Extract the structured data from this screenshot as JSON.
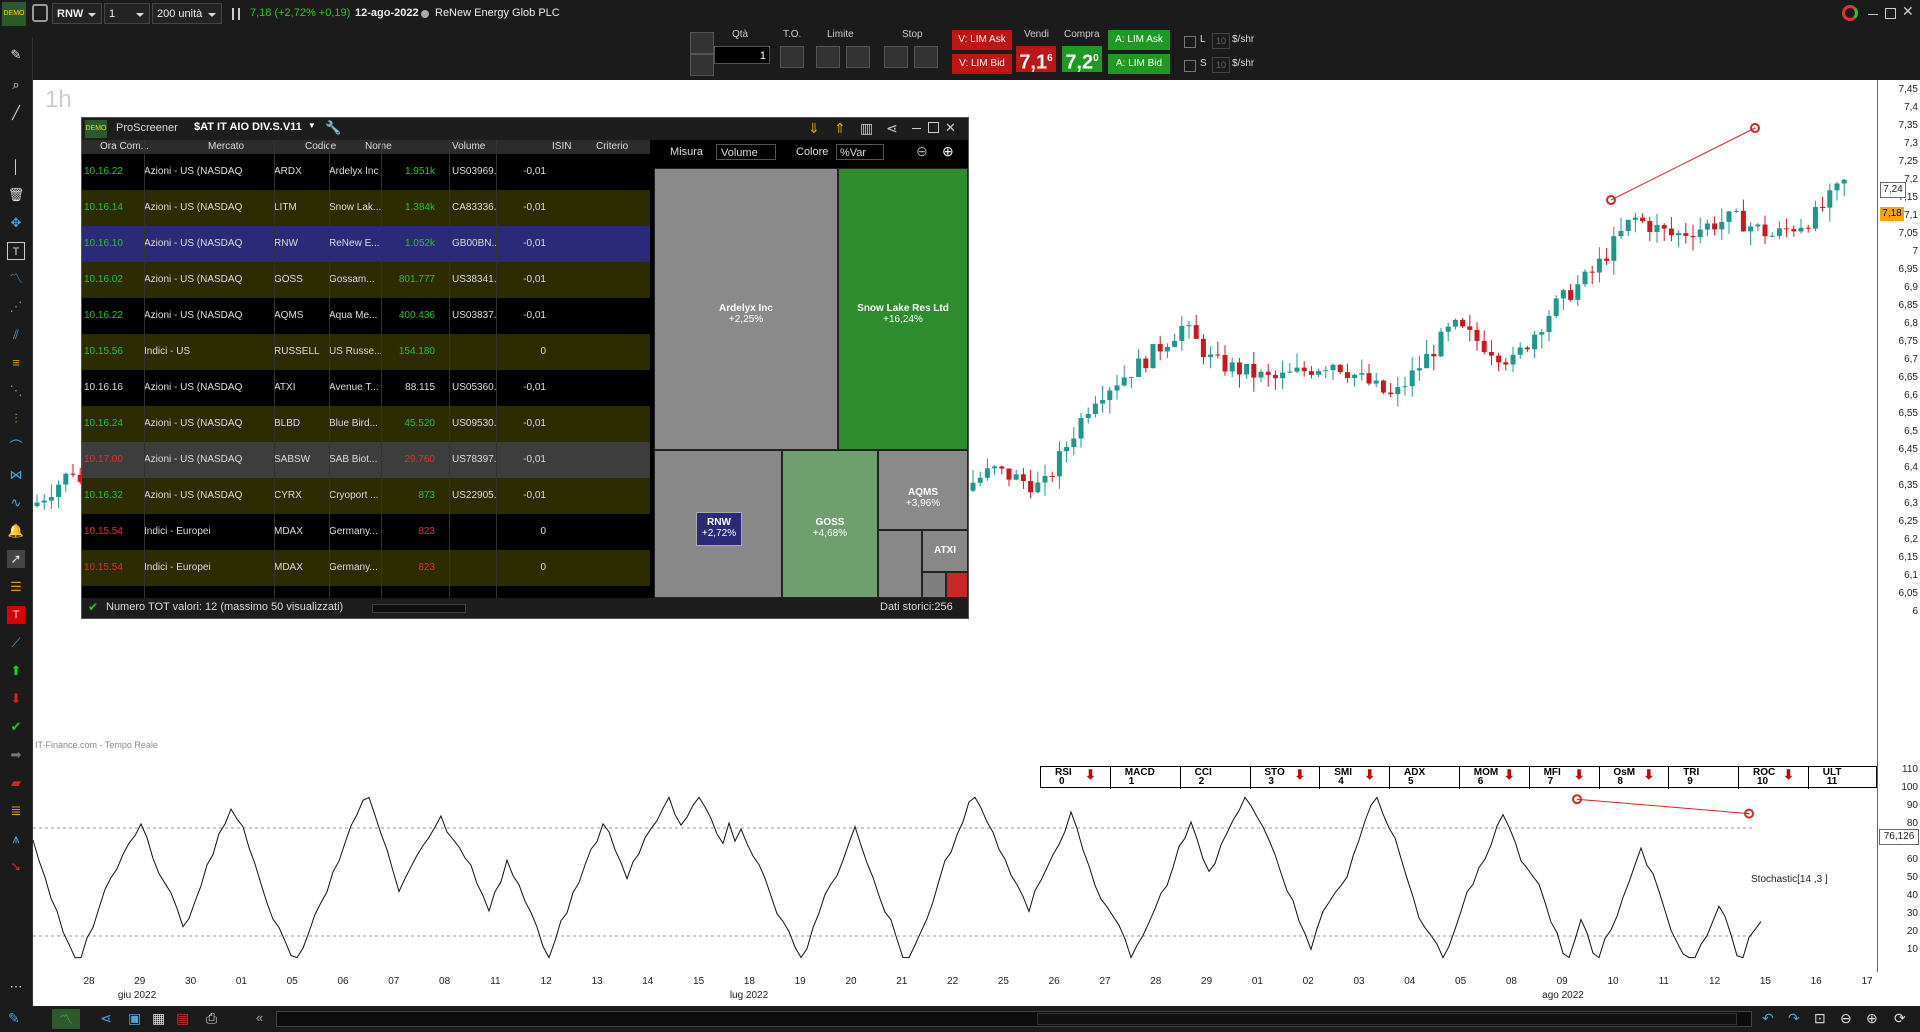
{
  "topbar": {
    "symbol": "RNW",
    "timeframe": "1 ora",
    "units": "200 unità",
    "last_price": "7,18 (+2,72% +0,19)",
    "date": "12-ago-2022",
    "company": "ReNew Energy Glob PLC",
    "logo_text": "DEMO"
  },
  "order": {
    "qty_label": "Qtà",
    "qty_value": "1",
    "to_label": "T.O.",
    "limit_label": "Limite",
    "stop_label": "Stop",
    "sell_label": "Vendi",
    "buy_label": "Compra",
    "v_lim_ask": "V: LIM Ask",
    "v_lim_bid": "V: LIM Bid",
    "a_lim_ask": "A: LIM Ask",
    "a_lim_bid": "A: LIM Bid",
    "sell_price": "7,1",
    "sell_sup": "6",
    "buy_price": "7,2",
    "buy_sup": "0",
    "l_label": "L",
    "s_label": "S",
    "l_val": "10",
    "s_val": "10",
    "per_share": "$/shr"
  },
  "chart": {
    "timeframe_label": "1h",
    "source": "IT-Finance.com - Tempo Reale",
    "price_axis": [
      "7,45",
      "7,4",
      "7,35",
      "7,3",
      "7,25",
      "7,2",
      "7,15",
      "7,1",
      "7,05",
      "7",
      "6,95",
      "6,9",
      "6,85",
      "6,8",
      "6,75",
      "6,7",
      "6,65",
      "6,6",
      "6,55",
      "6,5",
      "6,45",
      "6,4",
      "6,35",
      "6,3",
      "6,25",
      "6,2",
      "6,15",
      "6,1",
      "6,05",
      "6"
    ],
    "price_tag_1": "7,24",
    "price_tag_2": "7,18",
    "colors": {
      "up": "#1a9a8c",
      "down": "#d4141c",
      "bg": "#ffffff",
      "line": "#e02020"
    }
  },
  "oscillator": {
    "name": "Stochastic[14 ,3 ]",
    "value": "76,126",
    "axis": [
      "110",
      "100",
      "90",
      "80",
      "70",
      "60",
      "50",
      "40",
      "30",
      "20",
      "10"
    ],
    "indicators": [
      {
        "name": "RSI",
        "num": "0",
        "arrow": true
      },
      {
        "name": "MACD",
        "num": "1",
        "arrow": false
      },
      {
        "name": "CCI",
        "num": "2",
        "arrow": false
      },
      {
        "name": "STO",
        "num": "3",
        "arrow": true
      },
      {
        "name": "SMI",
        "num": "4",
        "arrow": true
      },
      {
        "name": "ADX",
        "num": "5",
        "arrow": false
      },
      {
        "name": "MOM",
        "num": "6",
        "arrow": true
      },
      {
        "name": "MFI",
        "num": "7",
        "arrow": true
      },
      {
        "name": "OsM",
        "num": "8",
        "arrow": true
      },
      {
        "name": "TRI",
        "num": "9",
        "arrow": false
      },
      {
        "name": "ROC",
        "num": "10",
        "arrow": true
      },
      {
        "name": "ULT",
        "num": "11",
        "arrow": false
      }
    ]
  },
  "xaxis": {
    "ticks": [
      "28",
      "29",
      "30",
      "01",
      "05",
      "06",
      "07",
      "08",
      "11",
      "12",
      "13",
      "14",
      "15",
      "18",
      "19",
      "20",
      "21",
      "22",
      "25",
      "26",
      "27",
      "28",
      "29",
      "01",
      "02",
      "03",
      "04",
      "05",
      "08",
      "09",
      "10",
      "11",
      "12",
      "15",
      "16",
      "17"
    ],
    "months": [
      "giu 2022",
      "lug 2022",
      "ago 2022"
    ]
  },
  "screener": {
    "app": "ProScreener",
    "name": "$AT IT AIO DIV.S.V11",
    "columns": [
      "Ora Com...",
      "Mercato",
      "Codice",
      "Nome",
      "Volume",
      "ISIN",
      "Criterio"
    ],
    "rows": [
      {
        "time": "10.16.22",
        "market": "Azioni - US (NASDAQ",
        "code": "ARDX",
        "name": "Ardelyx Inc",
        "volume": "1.951k",
        "isin": "US03969...",
        "crit": "-0,01",
        "bg": "#000000",
        "tc": "#27c627",
        "vc": "#27c627"
      },
      {
        "time": "10.16.14",
        "market": "Azioni - US (NASDAQ",
        "code": "LITM",
        "name": "Snow Lak...",
        "volume": "1.384k",
        "isin": "CA83336...",
        "crit": "-0,01",
        "bg": "#2d2b00",
        "tc": "#27c627",
        "vc": "#27c627"
      },
      {
        "time": "10.16.10",
        "market": "Azioni - US (NASDAQ",
        "code": "RNW",
        "name": "ReNew E...",
        "volume": "1.052k",
        "isin": "GB00BN...",
        "crit": "-0,01",
        "bg": "#2a2a78",
        "tc": "#27c627",
        "vc": "#27c627"
      },
      {
        "time": "10.16.02",
        "market": "Azioni - US (NASDAQ",
        "code": "GOSS",
        "name": "Gossam...",
        "volume": "801.777",
        "isin": "US38341...",
        "crit": "-0,01",
        "bg": "#2d2b00",
        "tc": "#27c627",
        "vc": "#27c627"
      },
      {
        "time": "10.16.22",
        "market": "Azioni - US (NASDAQ",
        "code": "AQMS",
        "name": "Aqua Me...",
        "volume": "400.436",
        "isin": "US03837...",
        "crit": "-0,01",
        "bg": "#000000",
        "tc": "#27c627",
        "vc": "#27c627"
      },
      {
        "time": "10.15.56",
        "market": "Indici - US",
        "code": "RUSSELL",
        "name": "US Russe...",
        "volume": "154.180",
        "isin": "",
        "crit": "0",
        "bg": "#2d2b00",
        "tc": "#27c627",
        "vc": "#27c627"
      },
      {
        "time": "10.16.16",
        "market": "Azioni - US (NASDAQ",
        "code": "ATXI",
        "name": "Avenue T...",
        "volume": "88.115",
        "isin": "US05360...",
        "crit": "-0,01",
        "bg": "#000000",
        "tc": "#dddddd",
        "vc": "#dddddd"
      },
      {
        "time": "10.16.24",
        "market": "Azioni - US (NASDAQ",
        "code": "BLBD",
        "name": "Blue Bird...",
        "volume": "45.520",
        "isin": "US09530...",
        "crit": "-0,01",
        "bg": "#2d2b00",
        "tc": "#27c627",
        "vc": "#27c627"
      },
      {
        "time": "10.17.00",
        "market": "Azioni - US (NASDAQ",
        "code": "SABSW",
        "name": "SAB Biot...",
        "volume": "29.760",
        "isin": "US78397...",
        "crit": "-0,01",
        "bg": "#3d3d3d",
        "tc": "#e33030",
        "vc": "#e33030"
      },
      {
        "time": "10.16.32",
        "market": "Azioni - US (NASDAQ",
        "code": "CYRX",
        "name": "Cryoport ...",
        "volume": "873",
        "isin": "US22905...",
        "crit": "-0,01",
        "bg": "#2d2b00",
        "tc": "#27c627",
        "vc": "#27c627"
      },
      {
        "time": "10.15.54",
        "market": "Indici - Europei",
        "code": "MDAX",
        "name": "Germany...",
        "volume": "823",
        "isin": "",
        "crit": "0",
        "bg": "#000000",
        "tc": "#e33030",
        "vc": "#e33030"
      },
      {
        "time": "10.15.54",
        "market": "Indici - Europei",
        "code": "MDAX",
        "name": "Germany...",
        "volume": "823",
        "isin": "",
        "crit": "0",
        "bg": "#2d2b00",
        "tc": "#e33030",
        "vc": "#e33030"
      }
    ],
    "measure_label": "Misura",
    "measure_value": "Volume",
    "color_label": "Colore",
    "color_value": "%Var",
    "tiles": [
      {
        "name": "Ardelyx Inc",
        "pct": "+2,25%"
      },
      {
        "name": "Snow Lake Res Ltd",
        "pct": "+16,24%"
      },
      {
        "name": "RNW",
        "pct": "+2,72%"
      },
      {
        "name": "GOSS",
        "pct": "+4,68%"
      },
      {
        "name": "AQMS",
        "pct": "+3,96%"
      },
      {
        "name": "ATXI",
        "pct": ""
      }
    ],
    "status_left": "Numero TOT valori: 12 (massimo 50 visualizzati)",
    "status_right": "Dati storici:256"
  }
}
